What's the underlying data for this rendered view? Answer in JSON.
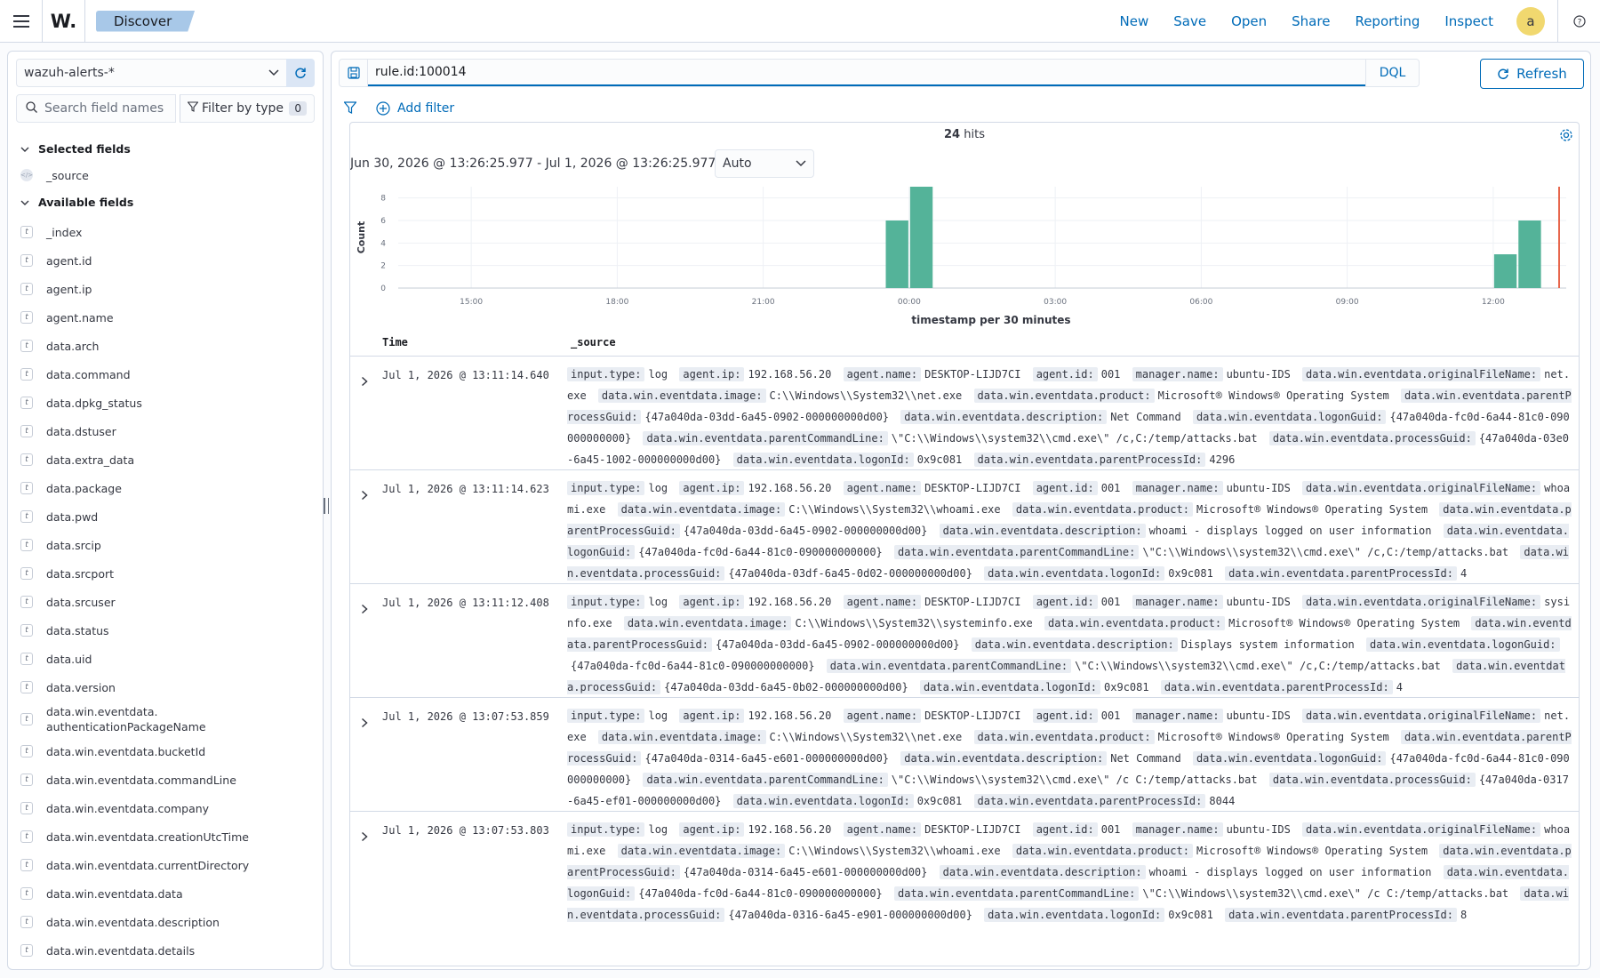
{
  "topbar": {
    "logo": "W.",
    "breadcrumb": "Discover",
    "nav": [
      "New",
      "Save",
      "Open",
      "Share",
      "Reporting",
      "Inspect"
    ],
    "avatar": "a"
  },
  "sidebar": {
    "index_pattern": "wazuh-alerts-*",
    "search_placeholder": "Search field names",
    "filter_by_type": "Filter by type",
    "filter_count": "0",
    "selected_title": "Selected fields",
    "selected_fields": [
      "_source"
    ],
    "available_title": "Available fields",
    "available_fields": [
      "_index",
      "agent.id",
      "agent.ip",
      "agent.name",
      "data.arch",
      "data.command",
      "data.dpkg_status",
      "data.dstuser",
      "data.extra_data",
      "data.package",
      "data.pwd",
      "data.srcip",
      "data.srcport",
      "data.srcuser",
      "data.status",
      "data.uid",
      "data.version",
      "data.win.eventdata.\nauthenticationPackageName",
      "data.win.eventdata.bucketId",
      "data.win.eventdata.commandLine",
      "data.win.eventdata.company",
      "data.win.eventdata.creationUtcTime",
      "data.win.eventdata.currentDirectory",
      "data.win.eventdata.data",
      "data.win.eventdata.description",
      "data.win.eventdata.details"
    ]
  },
  "query": {
    "text": "rule.id:100014",
    "language": "DQL",
    "refresh_label": "Refresh",
    "add_filter": "Add filter"
  },
  "results": {
    "hits_count": "24",
    "hits_label": "hits",
    "range": "Jun 30, 2026 @ 13:26:25.977 - Jul 1, 2026 @ 13:26:25.977 per",
    "interval": "Auto",
    "col_time": "Time",
    "col_source": "_source"
  },
  "chart_data": {
    "type": "bar",
    "x": [
      "13:30",
      "14:00",
      "14:30",
      "15:00",
      "15:30",
      "16:00",
      "16:30",
      "17:00",
      "17:30",
      "18:00",
      "18:30",
      "19:00",
      "19:30",
      "20:00",
      "20:30",
      "21:00",
      "21:30",
      "22:00",
      "22:30",
      "23:00",
      "23:30",
      "00:00",
      "00:30",
      "01:00",
      "01:30",
      "02:00",
      "02:30",
      "03:00",
      "03:30",
      "04:00",
      "04:30",
      "05:00",
      "05:30",
      "06:00",
      "06:30",
      "07:00",
      "07:30",
      "08:00",
      "08:30",
      "09:00",
      "09:30",
      "10:00",
      "10:30",
      "11:00",
      "11:30",
      "12:00",
      "12:30",
      "13:00"
    ],
    "values": [
      0,
      0,
      0,
      0,
      0,
      0,
      0,
      0,
      0,
      0,
      0,
      0,
      0,
      0,
      0,
      0,
      0,
      0,
      0,
      0,
      6,
      9,
      0,
      0,
      0,
      0,
      0,
      0,
      0,
      0,
      0,
      0,
      0,
      0,
      0,
      0,
      0,
      0,
      0,
      0,
      0,
      0,
      0,
      0,
      0,
      3,
      6,
      0
    ],
    "xticks": [
      "15:00",
      "18:00",
      "21:00",
      "00:00",
      "03:00",
      "06:00",
      "09:00",
      "12:00"
    ],
    "yticks": [
      0,
      2,
      4,
      6,
      8
    ],
    "ylim": [
      0,
      9
    ],
    "xlabel": "timestamp per 30 minutes",
    "ylabel": "Count",
    "bar_color": "#54b399",
    "now_marker_color": "#e7664c",
    "grid": true
  },
  "docs": [
    {
      "time": "Jul 1, 2026 @ 13:11:14.640",
      "fields": [
        [
          "input.type:",
          "log"
        ],
        [
          "agent.ip:",
          "192.168.56.20"
        ],
        [
          "agent.name:",
          "DESKTOP-LIJD7CI"
        ],
        [
          "agent.id:",
          "001"
        ],
        [
          "manager.name:",
          "ubuntu-IDS"
        ],
        [
          "data.win.eventdata.originalFileName:",
          "net.exe"
        ],
        [
          "data.win.eventdata.image:",
          "C:\\\\Windows\\\\System32\\\\net.exe"
        ],
        [
          "data.win.eventdata.product:",
          "Microsoft® Windows® Operating System"
        ],
        [
          "data.win.eventdata.parentProcessGuid:",
          "{47a040da-03dd-6a45-0902-000000000d00}"
        ],
        [
          "data.win.eventdata.description:",
          "Net Command"
        ],
        [
          "data.win.eventdata.logonGuid:",
          "{47a040da-fc0d-6a44-81c0-090000000000}"
        ],
        [
          "data.win.eventdata.parentCommandLine:",
          "\\\"C:\\\\Windows\\\\system32\\\\cmd.exe\\\" /c,C:/temp/attacks.bat"
        ],
        [
          "data.win.eventdata.processGuid:",
          "{47a040da-03e0-6a45-1002-000000000d00}"
        ],
        [
          "data.win.eventdata.logonId:",
          "0x9c081"
        ],
        [
          "data.win.eventdata.parentProcessId:",
          "4296"
        ]
      ]
    },
    {
      "time": "Jul 1, 2026 @ 13:11:14.623",
      "fields": [
        [
          "input.type:",
          "log"
        ],
        [
          "agent.ip:",
          "192.168.56.20"
        ],
        [
          "agent.name:",
          "DESKTOP-LIJD7CI"
        ],
        [
          "agent.id:",
          "001"
        ],
        [
          "manager.name:",
          "ubuntu-IDS"
        ],
        [
          "data.win.eventdata.originalFileName:",
          "whoami.exe"
        ],
        [
          "data.win.eventdata.image:",
          "C:\\\\Windows\\\\System32\\\\whoami.exe"
        ],
        [
          "data.win.eventdata.product:",
          "Microsoft® Windows® Operating System"
        ],
        [
          "data.win.eventdata.parentProcessGuid:",
          "{47a040da-03dd-6a45-0902-000000000d00}"
        ],
        [
          "data.win.eventdata.description:",
          "whoami - displays logged on user information"
        ],
        [
          "data.win.eventdata.logonGuid:",
          "{47a040da-fc0d-6a44-81c0-090000000000}"
        ],
        [
          "data.win.eventdata.parentCommandLine:",
          "\\\"C:\\\\Windows\\\\system32\\\\cmd.exe\\\" /c,C:/temp/attacks.bat"
        ],
        [
          "data.win.eventdata.processGuid:",
          "{47a040da-03df-6a45-0d02-000000000d00}"
        ],
        [
          "data.win.eventdata.logonId:",
          "0x9c081"
        ],
        [
          "data.win.eventdata.parentProcessId:",
          "4"
        ]
      ]
    },
    {
      "time": "Jul 1, 2026 @ 13:11:12.408",
      "fields": [
        [
          "input.type:",
          "log"
        ],
        [
          "agent.ip:",
          "192.168.56.20"
        ],
        [
          "agent.name:",
          "DESKTOP-LIJD7CI"
        ],
        [
          "agent.id:",
          "001"
        ],
        [
          "manager.name:",
          "ubuntu-IDS"
        ],
        [
          "data.win.eventdata.originalFileName:",
          "sysinfo.exe"
        ],
        [
          "data.win.eventdata.image:",
          "C:\\\\Windows\\\\System32\\\\systeminfo.exe"
        ],
        [
          "data.win.eventdata.product:",
          "Microsoft® Windows® Operating System"
        ],
        [
          "data.win.eventdata.parentProcessGuid:",
          "{47a040da-03dd-6a45-0902-000000000d00}"
        ],
        [
          "data.win.eventdata.description:",
          "Displays system information"
        ],
        [
          "data.win.eventdata.logonGuid:",
          "{47a040da-fc0d-6a44-81c0-090000000000}"
        ],
        [
          "data.win.eventdata.parentCommandLine:",
          "\\\"C:\\\\Windows\\\\system32\\\\cmd.exe\\\" /c,C:/temp/attacks.bat"
        ],
        [
          "data.win.eventdata.processGuid:",
          "{47a040da-03dd-6a45-0b02-000000000d00}"
        ],
        [
          "data.win.eventdata.logonId:",
          "0x9c081"
        ],
        [
          "data.win.eventdata.parentProcessId:",
          "4"
        ]
      ]
    },
    {
      "time": "Jul 1, 2026 @ 13:07:53.859",
      "fields": [
        [
          "input.type:",
          "log"
        ],
        [
          "agent.ip:",
          "192.168.56.20"
        ],
        [
          "agent.name:",
          "DESKTOP-LIJD7CI"
        ],
        [
          "agent.id:",
          "001"
        ],
        [
          "manager.name:",
          "ubuntu-IDS"
        ],
        [
          "data.win.eventdata.originalFileName:",
          "net.exe"
        ],
        [
          "data.win.eventdata.image:",
          "C:\\\\Windows\\\\System32\\\\net.exe"
        ],
        [
          "data.win.eventdata.product:",
          "Microsoft® Windows® Operating System"
        ],
        [
          "data.win.eventdata.parentProcessGuid:",
          "{47a040da-0314-6a45-e601-000000000d00}"
        ],
        [
          "data.win.eventdata.description:",
          "Net Command"
        ],
        [
          "data.win.eventdata.logonGuid:",
          "{47a040da-fc0d-6a44-81c0-090000000000}"
        ],
        [
          "data.win.eventdata.parentCommandLine:",
          "\\\"C:\\\\Windows\\\\system32\\\\cmd.exe\\\" /c C:/temp/attacks.bat"
        ],
        [
          "data.win.eventdata.processGuid:",
          "{47a040da-0317-6a45-ef01-000000000d00}"
        ],
        [
          "data.win.eventdata.logonId:",
          "0x9c081"
        ],
        [
          "data.win.eventdata.parentProcessId:",
          "8044"
        ]
      ]
    },
    {
      "time": "Jul 1, 2026 @ 13:07:53.803",
      "fields": [
        [
          "input.type:",
          "log"
        ],
        [
          "agent.ip:",
          "192.168.56.20"
        ],
        [
          "agent.name:",
          "DESKTOP-LIJD7CI"
        ],
        [
          "agent.id:",
          "001"
        ],
        [
          "manager.name:",
          "ubuntu-IDS"
        ],
        [
          "data.win.eventdata.originalFileName:",
          "whoami.exe"
        ],
        [
          "data.win.eventdata.image:",
          "C:\\\\Windows\\\\System32\\\\whoami.exe"
        ],
        [
          "data.win.eventdata.product:",
          "Microsoft® Windows® Operating System"
        ],
        [
          "data.win.eventdata.parentProcessGuid:",
          "{47a040da-0314-6a45-e601-000000000d00}"
        ],
        [
          "data.win.eventdata.description:",
          "whoami - displays logged on user information"
        ],
        [
          "data.win.eventdata.logonGuid:",
          "{47a040da-fc0d-6a44-81c0-090000000000}"
        ],
        [
          "data.win.eventdata.parentCommandLine:",
          "\\\"C:\\\\Windows\\\\system32\\\\cmd.exe\\\" /c C:/temp/attacks.bat"
        ],
        [
          "data.win.eventdata.processGuid:",
          "{47a040da-0316-6a45-e901-000000000d00}"
        ],
        [
          "data.win.eventdata.logonId:",
          "0x9c081"
        ],
        [
          "data.win.eventdata.parentProcessId:",
          "8"
        ]
      ]
    }
  ]
}
